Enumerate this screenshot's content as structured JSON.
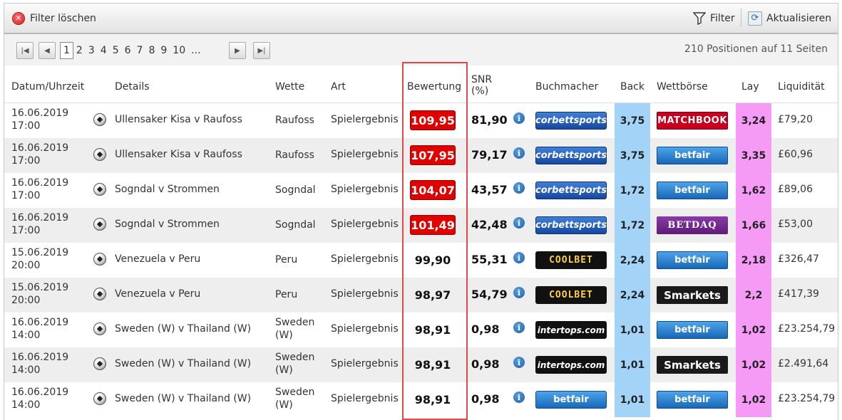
{
  "toolbar": {
    "clear_label": "Filter löschen",
    "filter_label": "Filter",
    "refresh_label": "Aktualisieren"
  },
  "pager": {
    "pages": [
      "1",
      "2",
      "3",
      "4",
      "5",
      "6",
      "7",
      "8",
      "9",
      "10",
      "..."
    ],
    "current": "1",
    "info": "210 Positionen auf 11 Seiten"
  },
  "columns": {
    "date": "Datum/Uhrzeit",
    "details": "Details",
    "wette": "Wette",
    "art": "Art",
    "rating": "Bewertung",
    "snr1": "SNR",
    "snr2": "(%)",
    "bookmaker": "Buchmacher",
    "back": "Back",
    "exchange": "Wettbörse",
    "lay": "Lay",
    "liquidity": "Liquidität"
  },
  "colors": {
    "back_bg": "#a3d4f7",
    "lay_bg": "#f59af5",
    "rating_high_bg": "#e00000",
    "highlight_border": "#e24a4a"
  },
  "rows": [
    {
      "date": "16.06.2019",
      "time": "17:00",
      "details": "Ullensaker Kisa v Raufoss",
      "wette": "Raufoss",
      "wette2": "",
      "art": "Spielergebnis",
      "rating": "109,95",
      "rating_high": true,
      "snr": "81,90",
      "bookmaker": "corbettsports",
      "back": "3,75",
      "exchange": "MATCHBOOK",
      "lay": "3,24",
      "liquidity": "£79,20"
    },
    {
      "date": "16.06.2019",
      "time": "17:00",
      "details": "Ullensaker Kisa v Raufoss",
      "wette": "Raufoss",
      "wette2": "",
      "art": "Spielergebnis",
      "rating": "107,95",
      "rating_high": true,
      "snr": "79,17",
      "bookmaker": "corbettsports",
      "back": "3,75",
      "exchange": "betfair",
      "lay": "3,35",
      "liquidity": "£60,96"
    },
    {
      "date": "16.06.2019",
      "time": "17:00",
      "details": "Sogndal v Strommen",
      "wette": "Sogndal",
      "wette2": "",
      "art": "Spielergebnis",
      "rating": "104,07",
      "rating_high": true,
      "snr": "43,57",
      "bookmaker": "corbettsports",
      "back": "1,72",
      "exchange": "betfair",
      "lay": "1,62",
      "liquidity": "£89,06"
    },
    {
      "date": "16.06.2019",
      "time": "17:00",
      "details": "Sogndal v Strommen",
      "wette": "Sogndal",
      "wette2": "",
      "art": "Spielergebnis",
      "rating": "101,49",
      "rating_high": true,
      "snr": "42,48",
      "bookmaker": "corbettsports",
      "back": "1,72",
      "exchange": "BETDAQ",
      "lay": "1,66",
      "liquidity": "£53,00"
    },
    {
      "date": "15.06.2019",
      "time": "20:00",
      "details": "Venezuela v Peru",
      "wette": "Peru",
      "wette2": "",
      "art": "Spielergebnis",
      "rating": "99,90",
      "rating_high": false,
      "snr": "55,31",
      "bookmaker": "COOLBET",
      "back": "2,24",
      "exchange": "betfair",
      "lay": "2,18",
      "liquidity": "£326,47"
    },
    {
      "date": "15.06.2019",
      "time": "20:00",
      "details": "Venezuela v Peru",
      "wette": "Peru",
      "wette2": "",
      "art": "Spielergebnis",
      "rating": "98,97",
      "rating_high": false,
      "snr": "54,79",
      "bookmaker": "COOLBET",
      "back": "2,24",
      "exchange": "Smarkets",
      "lay": "2,2",
      "liquidity": "£417,39"
    },
    {
      "date": "16.06.2019",
      "time": "14:00",
      "details": "Sweden (W) v Thailand (W)",
      "wette": "Sweden",
      "wette2": "(W)",
      "art": "Spielergebnis",
      "rating": "98,91",
      "rating_high": false,
      "snr": "0,98",
      "bookmaker": "intertops.com",
      "back": "1,01",
      "exchange": "betfair",
      "lay": "1,02",
      "liquidity": "£23.254,79"
    },
    {
      "date": "16.06.2019",
      "time": "14:00",
      "details": "Sweden (W) v Thailand (W)",
      "wette": "Sweden",
      "wette2": "(W)",
      "art": "Spielergebnis",
      "rating": "98,91",
      "rating_high": false,
      "snr": "0,98",
      "bookmaker": "intertops.com",
      "back": "1,01",
      "exchange": "Smarkets",
      "lay": "1,02",
      "liquidity": "£2.491,64"
    },
    {
      "date": "16.06.2019",
      "time": "14:00",
      "details": "Sweden (W) v Thailand (W)",
      "wette": "Sweden",
      "wette2": "(W)",
      "art": "Spielergebnis",
      "rating": "98,91",
      "rating_high": false,
      "snr": "0,98",
      "bookmaker": "betfair",
      "back": "1,01",
      "exchange": "betfair",
      "lay": "1,02",
      "liquidity": "£23.254,79"
    }
  ]
}
